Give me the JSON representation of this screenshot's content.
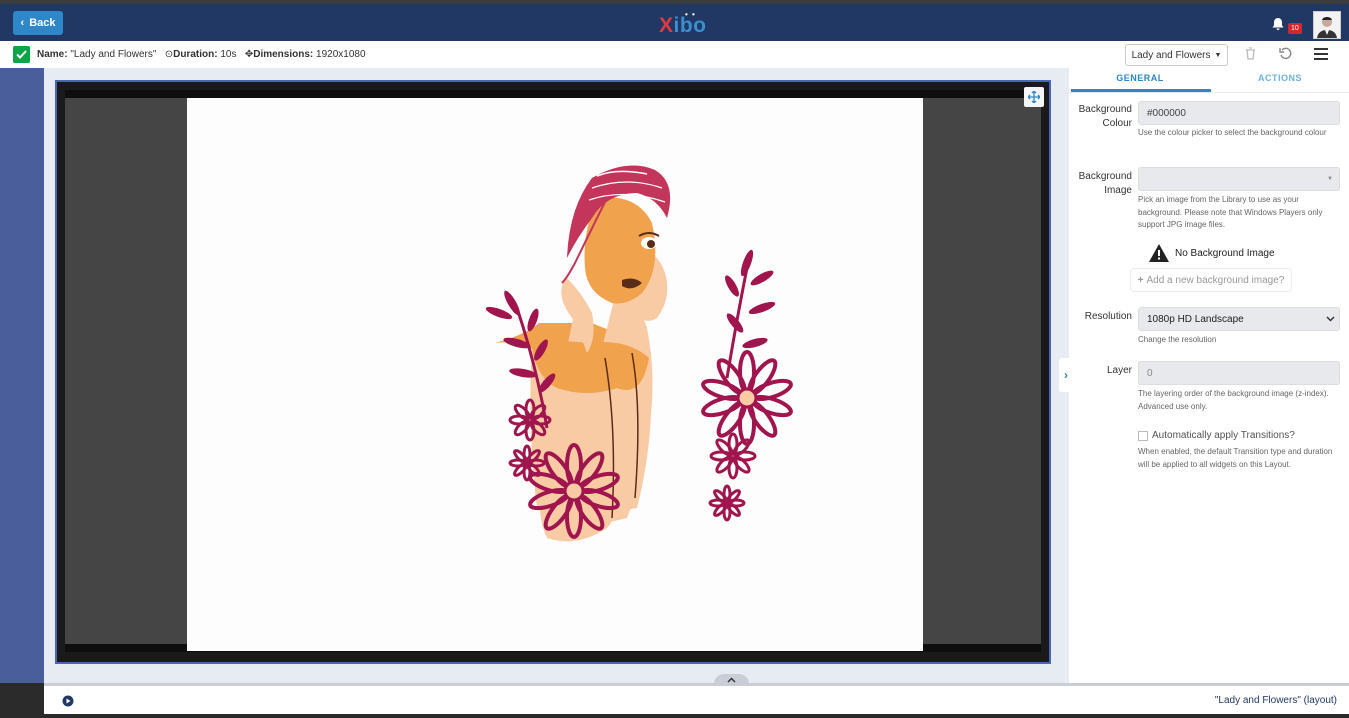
{
  "header": {
    "back_label": "Back",
    "logo_x": "X",
    "logo_rest": "ibo",
    "logo_dots": "• •",
    "notification_count": "10"
  },
  "info": {
    "name_label": "Name:",
    "name_value": "\"Lady and Flowers\"",
    "duration_label": "Duration:",
    "duration_value": "10s",
    "dimensions_label": "Dimensions:",
    "dimensions_value": "1920x1080",
    "layout_select": "Lady and Flowers"
  },
  "panel": {
    "tabs": [
      "GENERAL",
      "ACTIONS"
    ],
    "bg_colour_label": "Background Colour",
    "bg_colour_value": "#000000",
    "bg_colour_help": "Use the colour picker to select the background colour",
    "bg_image_label": "Background Image",
    "bg_image_value": "",
    "bg_image_help": "Pick an image from the Library to use as your background. Please note that Windows Players only support JPG image files.",
    "no_bg_text": "No Background Image",
    "add_bg_label": "Add a new background image?",
    "resolution_label": "Resolution",
    "resolution_value": "1080p HD Landscape",
    "resolution_help": "Change the resolution",
    "layer_label": "Layer",
    "layer_value": "0",
    "layer_help": "The layering order of the background image (z-index). Advanced use only.",
    "transitions_label": "Automatically apply Transitions?",
    "transitions_help": "When enabled, the default Transition type and duration will be applied to all widgets on this Layout."
  },
  "footer": {
    "status_text": "\"Lady and Flowers\" (layout)"
  },
  "colors": {
    "topbar": "#203863",
    "accent": "#2e87c8",
    "leftstrip": "#4a5e9b",
    "skin": "#f8cba4",
    "skin_shadow": "#f0a24d",
    "hair": "#c4355b",
    "flower": "#a0154e"
  }
}
